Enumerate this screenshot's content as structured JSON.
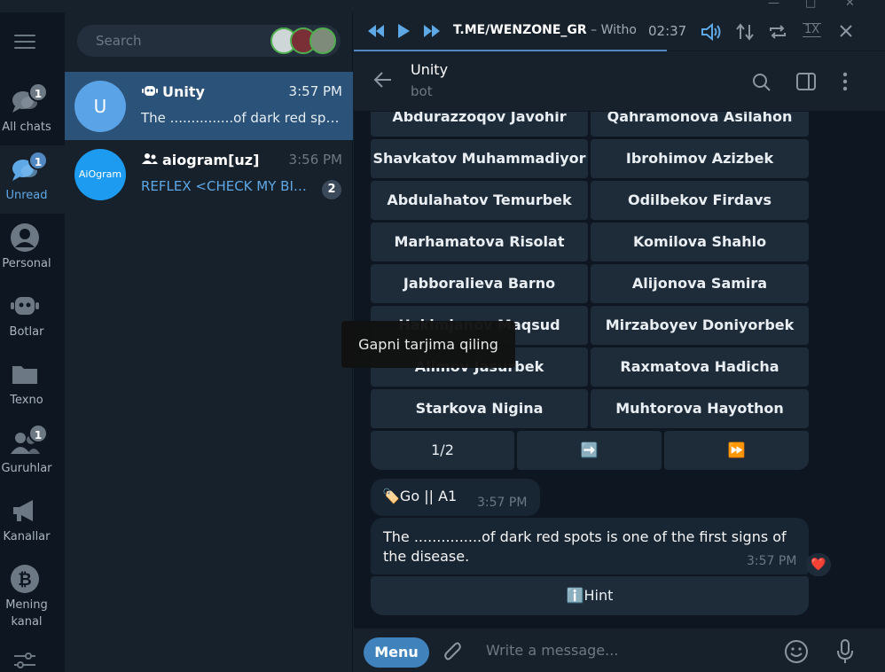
{
  "window": {
    "minimize": "—",
    "maximize": "□",
    "close": "✕"
  },
  "rail": {
    "folders": [
      {
        "label": "All chats",
        "badge": "1",
        "icon": "chats-icon"
      },
      {
        "label": "Unread",
        "badge": "1",
        "icon": "unread-chat-icon"
      },
      {
        "label": "Personal",
        "badge": "",
        "icon": "person-icon"
      },
      {
        "label": "Botlar",
        "badge": "",
        "icon": "bot-icon"
      },
      {
        "label": "Texno",
        "badge": "",
        "icon": "folder-icon"
      },
      {
        "label": "Guruhlar",
        "badge": "1",
        "icon": "group-icon"
      },
      {
        "label": "Kanallar",
        "badge": "",
        "icon": "megaphone-icon"
      },
      {
        "label": "Mening kanal",
        "badge": "",
        "icon": "bitcoin-icon"
      }
    ]
  },
  "search": {
    "placeholder": "Search"
  },
  "chats": [
    {
      "name": "Unity",
      "time": "3:57 PM",
      "preview": "The ...............of dark red spots is one of the first signs of the disease.",
      "avatar": "U",
      "unread": ""
    },
    {
      "name": "aiogram[uz]",
      "time": "3:56 PM",
      "preview": "REFLEX <CHECK MY BIO/...",
      "avatar": "AiOgram",
      "unread": "2"
    }
  ],
  "player": {
    "performer": "T.ME/WENZONE_GR",
    "separator": " – ",
    "track": "Without",
    "time": "02:37",
    "speed": "1X",
    "progress": 0.59
  },
  "header": {
    "name": "Unity",
    "status": "bot"
  },
  "keyboard": {
    "rows": [
      [
        "Abdurazzoqov Javohir",
        "Qahramonova Asilahon"
      ],
      [
        "Shavkatov Muhammadiyor",
        "Ibrohimov Azizbek"
      ],
      [
        "Abdulahatov Temurbek",
        "Odilbekov Firdavs"
      ],
      [
        "Marhamatova Risolat",
        "Komilova Shahlo"
      ],
      [
        "Jabboralieva Barno",
        "Alijonova Samira"
      ],
      [
        "Hakimjanov Maqsud",
        "Mirzaboyev Doniyorbek"
      ],
      [
        "Alimov Jasurbek",
        "Raxmatova Hadicha"
      ],
      [
        "Starkova Nigina",
        "Muhtorova Hayothon"
      ]
    ],
    "pager": [
      "1/2",
      "➡️",
      "⏩"
    ]
  },
  "messages": [
    {
      "text": "🏷️Go || A1",
      "time": "3:57 PM"
    },
    {
      "text": "The ...............of dark red spots is one of the first signs of the disease.",
      "time": "3:57 PM",
      "reaction": "❤️"
    }
  ],
  "hint_button": "ℹ️Hint",
  "tooltip": "Gapni tarjima qiling",
  "composer": {
    "menu": "Menu",
    "placeholder": "Write a message..."
  }
}
